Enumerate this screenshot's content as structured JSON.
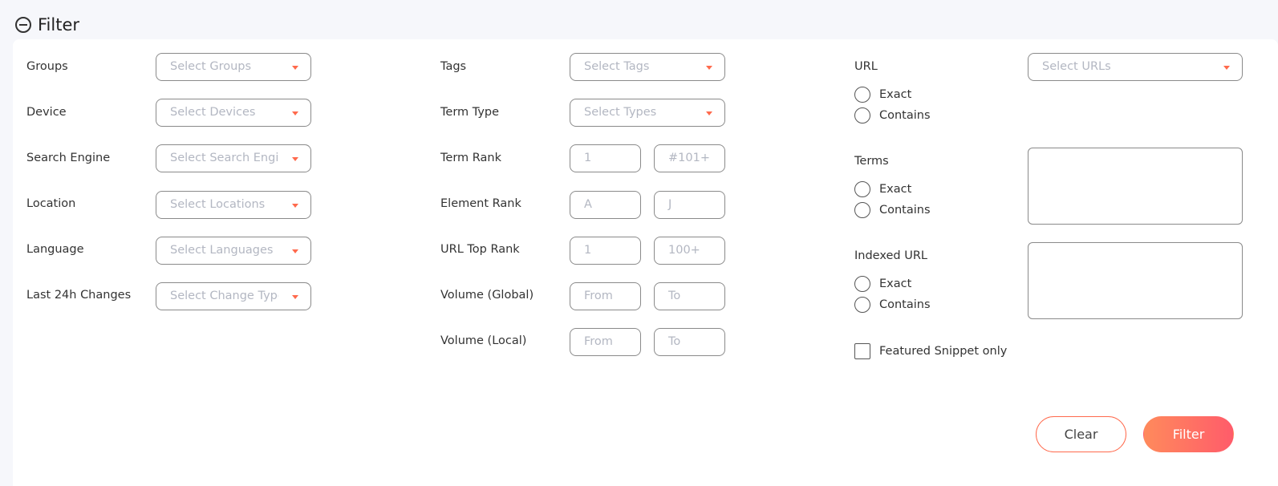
{
  "header": {
    "title": "Filter",
    "toggle_icon": "minus-circle-icon"
  },
  "col1": {
    "groups": {
      "label": "Groups",
      "placeholder": "Select Groups"
    },
    "device": {
      "label": "Device",
      "placeholder": "Select Devices"
    },
    "search_engine": {
      "label": "Search Engine",
      "placeholder": "Select Search Engines"
    },
    "location": {
      "label": "Location",
      "placeholder": "Select Locations"
    },
    "language": {
      "label": "Language",
      "placeholder": "Select Languages"
    },
    "changes": {
      "label": "Last 24h Changes",
      "placeholder": "Select Change Types"
    }
  },
  "col2": {
    "tags": {
      "label": "Tags",
      "placeholder": "Select Tags"
    },
    "term_type": {
      "label": "Term Type",
      "placeholder": "Select Types"
    },
    "term_rank": {
      "label": "Term Rank",
      "from": "1",
      "to": "#101+"
    },
    "element_rank": {
      "label": "Element Rank",
      "from": "A",
      "to": "J"
    },
    "url_top_rank": {
      "label": "URL Top Rank",
      "from": "1",
      "to": "100+"
    },
    "volume_global": {
      "label": "Volume (Global)",
      "from": "From",
      "to": "To"
    },
    "volume_local": {
      "label": "Volume (Local)",
      "from": "From",
      "to": "To"
    }
  },
  "col3": {
    "url": {
      "label": "URL",
      "placeholder": "Select URLs",
      "exact": "Exact",
      "contains": "Contains"
    },
    "terms": {
      "label": "Terms",
      "exact": "Exact",
      "contains": "Contains"
    },
    "indexed_url": {
      "label": "Indexed URL",
      "exact": "Exact",
      "contains": "Contains"
    },
    "featured_snippet": "Featured Snippet only"
  },
  "actions": {
    "clear": "Clear",
    "filter": "Filter"
  },
  "colors": {
    "accent": "#ff6a4d",
    "gradient_start": "#ff8a5c",
    "gradient_end": "#ff5c6a"
  }
}
